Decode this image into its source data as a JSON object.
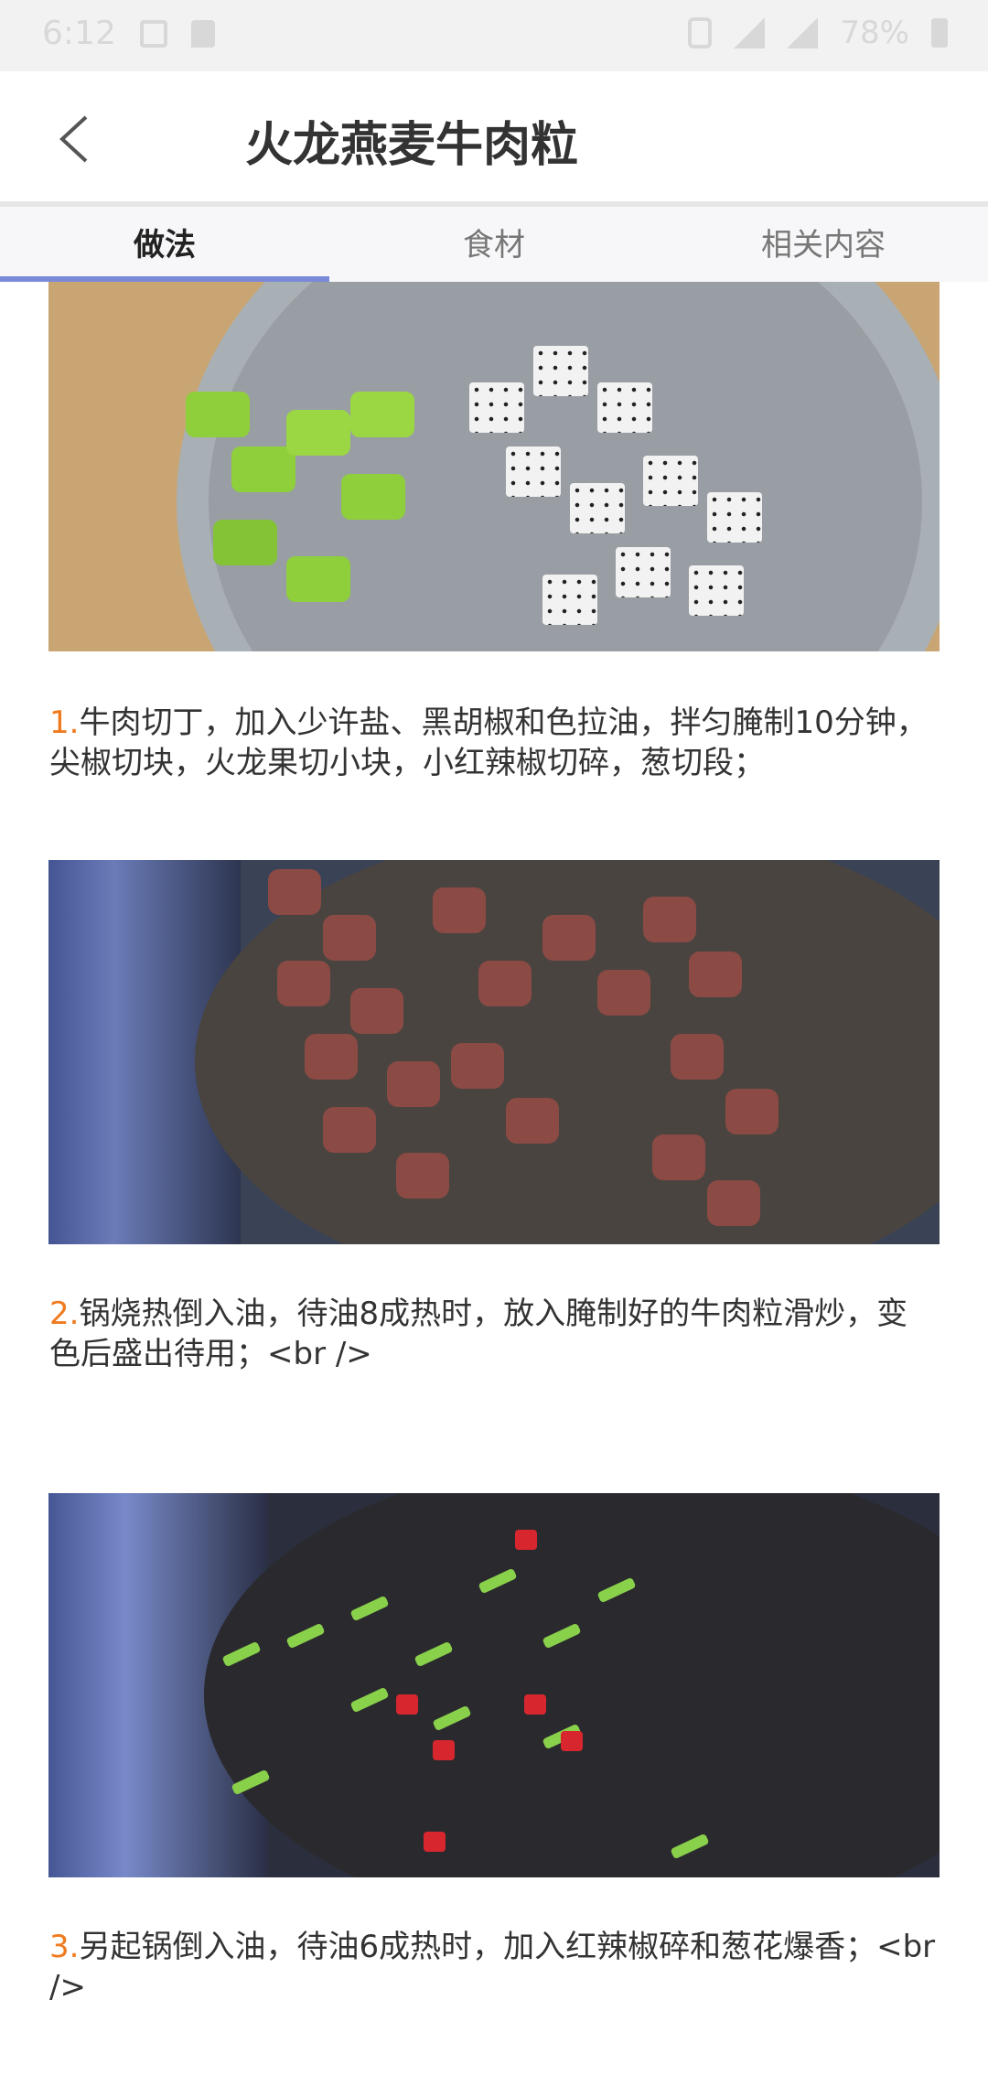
{
  "status_bar": {
    "time": "6:12",
    "battery": "78%"
  },
  "header": {
    "title": "火龙燕麦牛肉粒"
  },
  "tabs": [
    {
      "label": "做法",
      "active": true
    },
    {
      "label": "食材",
      "active": false
    },
    {
      "label": "相关内容",
      "active": false
    }
  ],
  "steps": [
    {
      "number": "1.",
      "text": "牛肉切丁，加入少许盐、黑胡椒和色拉油，拌匀腌制10分钟，尖椒切块，火龙果切小块，小红辣椒切碎，葱切段；"
    },
    {
      "number": "2.",
      "text": "锅烧热倒入油，待油8成热时，放入腌制好的牛肉粒滑炒，变色后盛出待用；<br />"
    },
    {
      "number": "3.",
      "text": "另起锅倒入油，待油6成热时，加入红辣椒碎和葱花爆香；<br />"
    }
  ],
  "colors": {
    "accent": "#7a89d8",
    "step_number": "#f07a1e",
    "text": "#333333"
  }
}
